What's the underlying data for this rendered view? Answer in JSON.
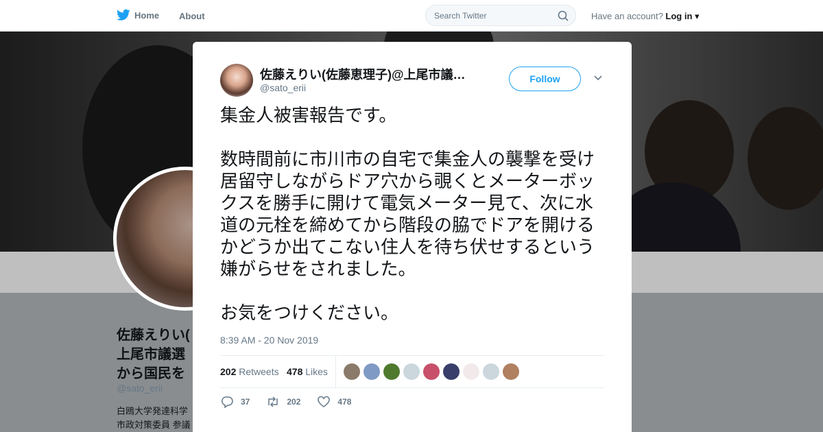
{
  "nav": {
    "home_label": "Home",
    "about_label": "About",
    "search_placeholder": "Search Twitter",
    "have_account": "Have an account?",
    "login_label": "Log in"
  },
  "profile": {
    "name_line1": "佐藤えりい(",
    "name_line2": "上尾市議選",
    "name_line3": "から国民を",
    "handle": "@sato_erii",
    "bio_line1": "白鴎大学発達科学",
    "bio_line2": "市政対策委員 参議"
  },
  "tweet": {
    "author_name": "佐藤えりい(佐藤恵理子)@上尾市議…",
    "author_handle": "@sato_erii",
    "follow_label": "Follow",
    "text": "集金人被害報告です。\n\n数時間前に市川市の自宅で集金人の襲撃を受け居留守しながらドア穴から覗くとメーターボックスを勝手に開けて電気メーター見て、次に水道の元栓を締めてから階段の脇でドアを開けるかどうか出てこない住人を待ち伏せするという嫌がらせをされました。\n\nお気をつけください。",
    "timestamp": "8:39 AM - 20 Nov 2019",
    "retweets_count": "202",
    "retweets_label": "Retweets",
    "likes_count": "478",
    "likes_label": "Likes",
    "reply_count": "37",
    "retweet_action_count": "202",
    "like_action_count": "478"
  },
  "colors": {
    "accent": "#1da1f2",
    "text": "#14171a",
    "muted": "#657786"
  }
}
